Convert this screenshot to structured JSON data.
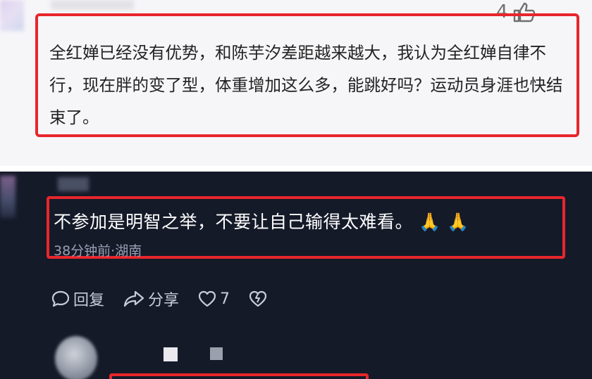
{
  "comment_top": {
    "text": "全红婵已经没有优势，和陈芋汐差距越来越大，我认为全红婵自律不行，现在胖的变了型，体重增加这么多，能跳好吗？运动员身涯也快结束了。",
    "like_count": "4",
    "like_icon": "thumbs-up-icon"
  },
  "comment_dark": {
    "text": "不参加是明智之举，不要让自己输得太难看。",
    "emoji": "🙏 🙏",
    "meta": "38分钟前·湖南",
    "actions": {
      "reply": {
        "icon": "comment-bubble-icon",
        "label": "回复"
      },
      "share": {
        "icon": "share-arrow-icon",
        "label": "分享"
      },
      "like": {
        "icon": "heart-icon",
        "count": "7"
      },
      "dislike": {
        "icon": "broken-heart-icon"
      }
    }
  },
  "colors": {
    "highlight_border": "#e8262c",
    "light_bg": "#f6f6f8",
    "dark_bg": "#151a29",
    "dark_text": "#ffffff",
    "meta_text": "#9aa0b3"
  }
}
